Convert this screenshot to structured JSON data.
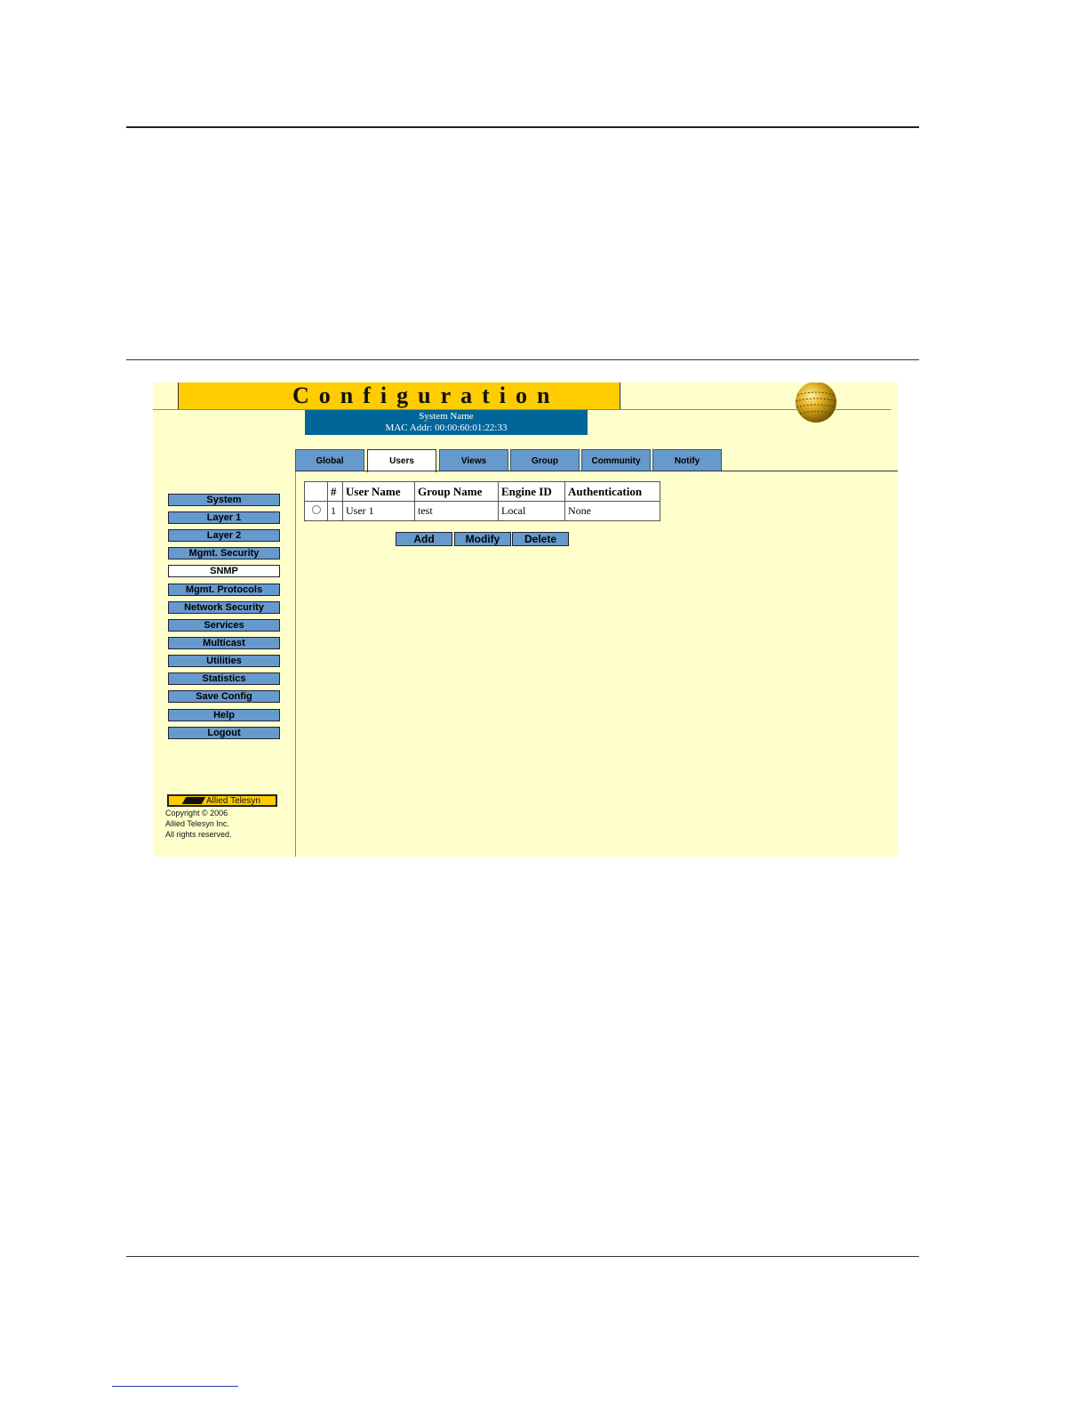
{
  "header": {
    "title": "Configuration",
    "system_name": "System Name",
    "mac_addr": "MAC Addr:  00:00:60:01:22:33"
  },
  "tabs": [
    {
      "label": "Global"
    },
    {
      "label": "Users",
      "active": true
    },
    {
      "label": "Views"
    },
    {
      "label": "Group"
    },
    {
      "label": "Community"
    },
    {
      "label": "Notify"
    }
  ],
  "nav": [
    {
      "label": "System"
    },
    {
      "label": "Layer 1"
    },
    {
      "label": "Layer 2"
    },
    {
      "label": "Mgmt. Security"
    },
    {
      "label": "SNMP",
      "active": true
    },
    {
      "label": "Mgmt. Protocols"
    },
    {
      "label": "Network Security"
    },
    {
      "label": "Services"
    },
    {
      "label": "Multicast"
    },
    {
      "label": "Utilities"
    },
    {
      "label": "Statistics"
    },
    {
      "label": "Save Config"
    },
    {
      "label": "Help"
    },
    {
      "label": "Logout"
    }
  ],
  "brand": {
    "logo": "Allied Telesyn",
    "copyright": [
      "Copyright © 2006",
      "Allied Telesyn Inc.",
      "All rights reserved."
    ]
  },
  "table": {
    "columns": [
      "",
      "#",
      "User Name",
      "Group Name",
      "Engine ID",
      "Authentication"
    ],
    "rows": [
      {
        "num": "1",
        "user": "User 1",
        "group": "test",
        "engine": "Local",
        "auth": "None"
      }
    ]
  },
  "actions": {
    "add": "Add",
    "modify": "Modify",
    "delete": "Delete"
  },
  "colors": {
    "title_bar": "#ffcc00",
    "button": "#6699cc",
    "panel": "#ffffcc",
    "sys_box": "#006699"
  }
}
